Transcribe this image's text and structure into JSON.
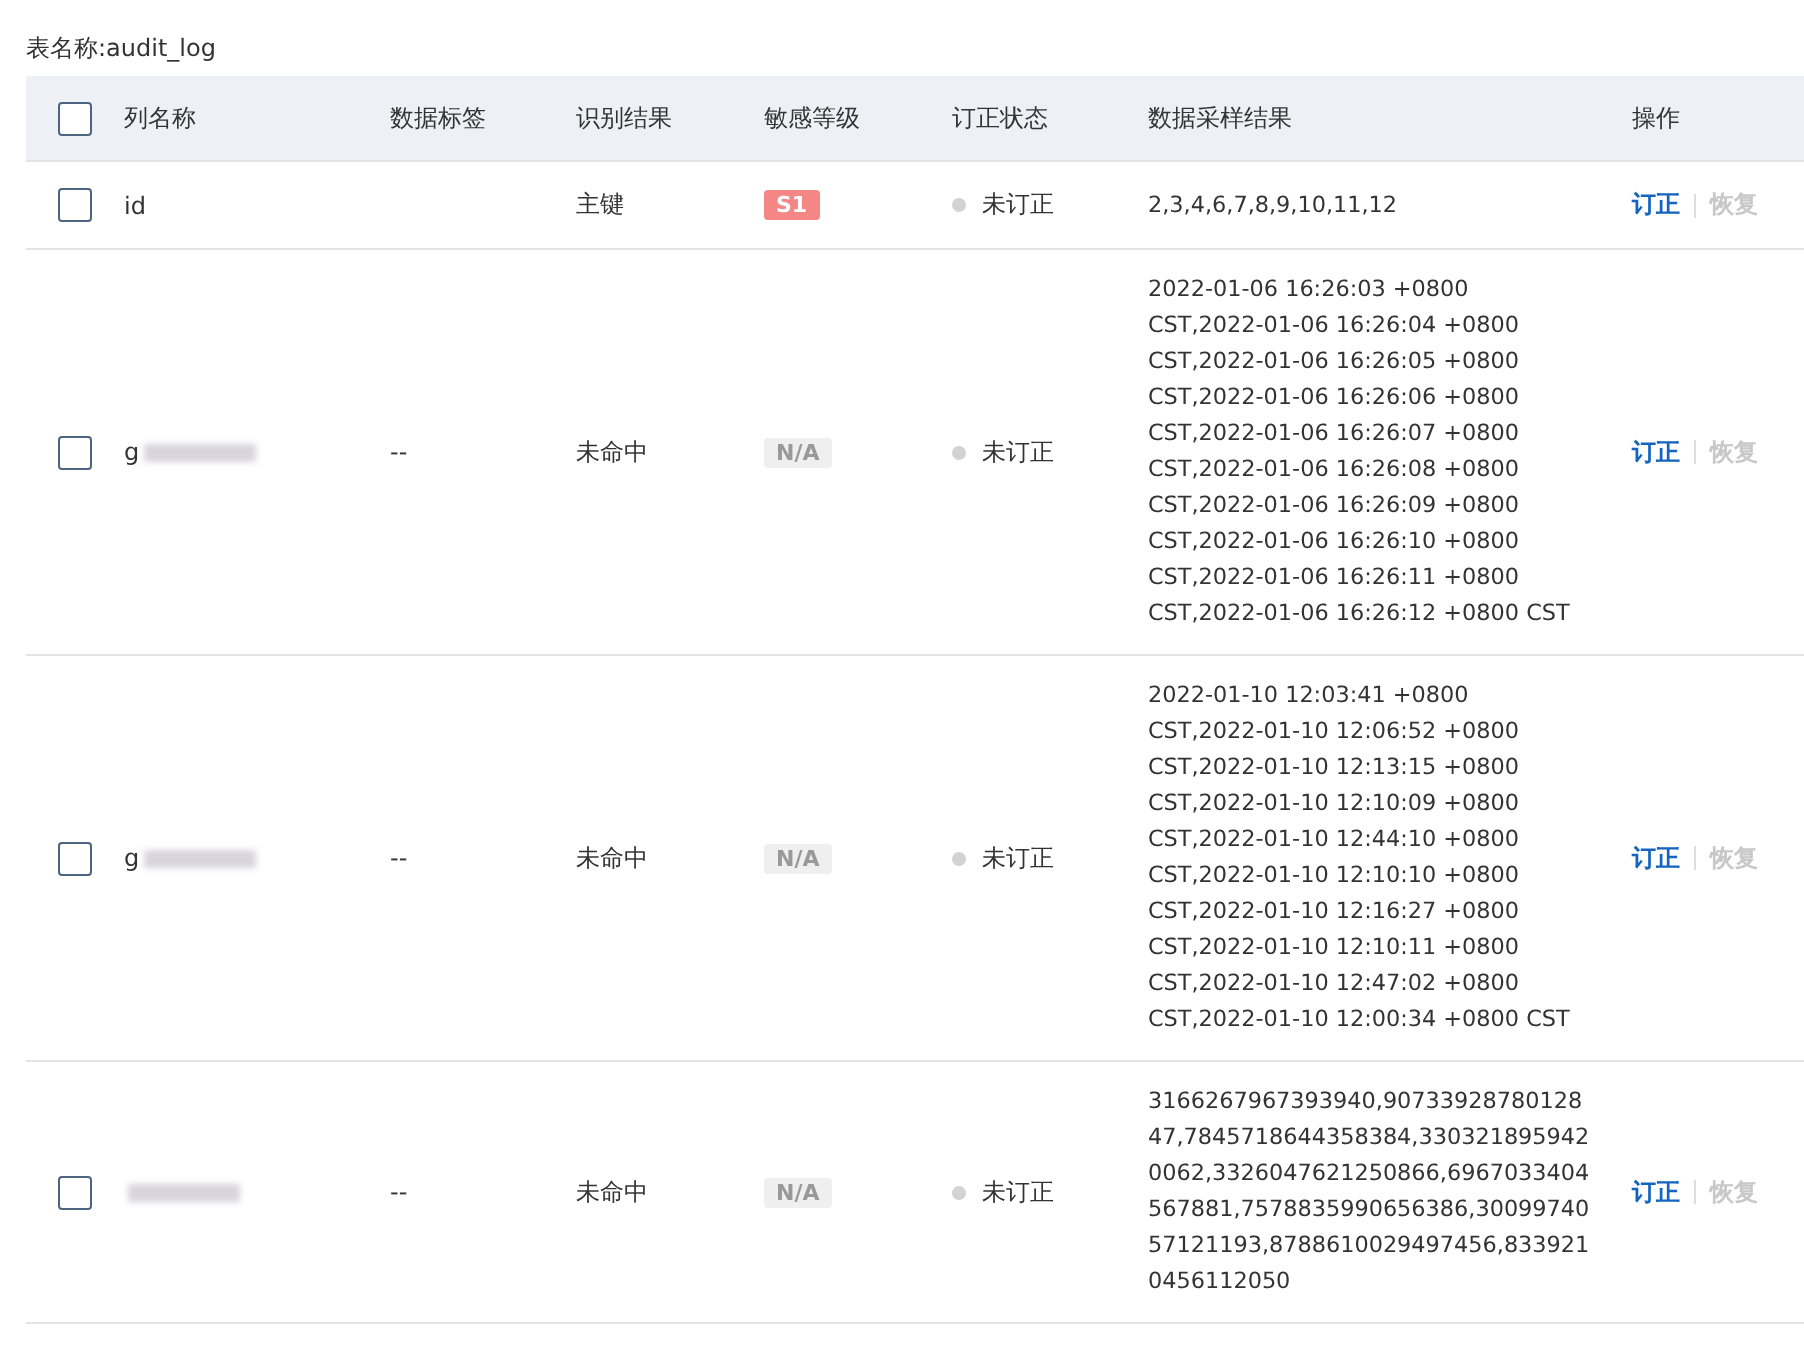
{
  "table_name": "表名称:audit_log",
  "table": {
    "header_checkbox": {
      "checked": false
    },
    "columns": [
      "列名称",
      "数据标签",
      "识别结果",
      "敏感等级",
      "订正状态",
      "数据采样结果",
      "操作"
    ],
    "rows": [
      {
        "checked": false,
        "name": "id",
        "name_redacted": false,
        "tag": "",
        "result": "主键",
        "level": {
          "kind": "s1",
          "label": "S1"
        },
        "status": {
          "corrected": false,
          "label": "未订正"
        },
        "sample": [
          "2,3,4,6,7,8,9,10,11,12"
        ],
        "actions": [
          {
            "label": "订正",
            "disabled": false
          },
          {
            "label": "恢复",
            "disabled": true
          }
        ]
      },
      {
        "checked": false,
        "name": "g",
        "name_redacted": true,
        "tag": "--",
        "result": "未命中",
        "level": {
          "kind": "na",
          "label": "N/A"
        },
        "status": {
          "corrected": false,
          "label": "未订正"
        },
        "sample": [
          "2022-01-06 16:26:03 +0800",
          "CST,2022-01-06 16:26:04 +0800",
          "CST,2022-01-06 16:26:05 +0800",
          "CST,2022-01-06 16:26:06 +0800",
          "CST,2022-01-06 16:26:07 +0800",
          "CST,2022-01-06 16:26:08 +0800",
          "CST,2022-01-06 16:26:09 +0800",
          "CST,2022-01-06 16:26:10 +0800",
          "CST,2022-01-06 16:26:11 +0800",
          "CST,2022-01-06 16:26:12 +0800 CST"
        ],
        "actions": [
          {
            "label": "订正",
            "disabled": false
          },
          {
            "label": "恢复",
            "disabled": true
          }
        ]
      },
      {
        "checked": false,
        "name": "g",
        "name_redacted": true,
        "tag": "--",
        "result": "未命中",
        "level": {
          "kind": "na",
          "label": "N/A"
        },
        "status": {
          "corrected": false,
          "label": "未订正"
        },
        "sample": [
          "2022-01-10 12:03:41 +0800",
          "CST,2022-01-10 12:06:52 +0800",
          "CST,2022-01-10 12:13:15 +0800",
          "CST,2022-01-10 12:10:09 +0800",
          "CST,2022-01-10 12:44:10 +0800",
          "CST,2022-01-10 12:10:10 +0800",
          "CST,2022-01-10 12:16:27 +0800",
          "CST,2022-01-10 12:10:11 +0800",
          "CST,2022-01-10 12:47:02 +0800",
          "CST,2022-01-10 12:00:34 +0800 CST"
        ],
        "actions": [
          {
            "label": "订正",
            "disabled": false
          },
          {
            "label": "恢复",
            "disabled": true
          }
        ]
      },
      {
        "checked": false,
        "name": "",
        "name_redacted": true,
        "tag": "--",
        "result": "未命中",
        "level": {
          "kind": "na",
          "label": "N/A"
        },
        "status": {
          "corrected": false,
          "label": "未订正"
        },
        "sample": [
          "3166267967393940,90733928780128",
          "47,7845718644358384,330321895942",
          "0062,3326047621250866,6967033404",
          "567881,7578835990656386,30099740",
          "57121193,8788610029497456,833921",
          "0456112050"
        ],
        "actions": [
          {
            "label": "订正",
            "disabled": false
          },
          {
            "label": "恢复",
            "disabled": true
          }
        ]
      }
    ]
  }
}
